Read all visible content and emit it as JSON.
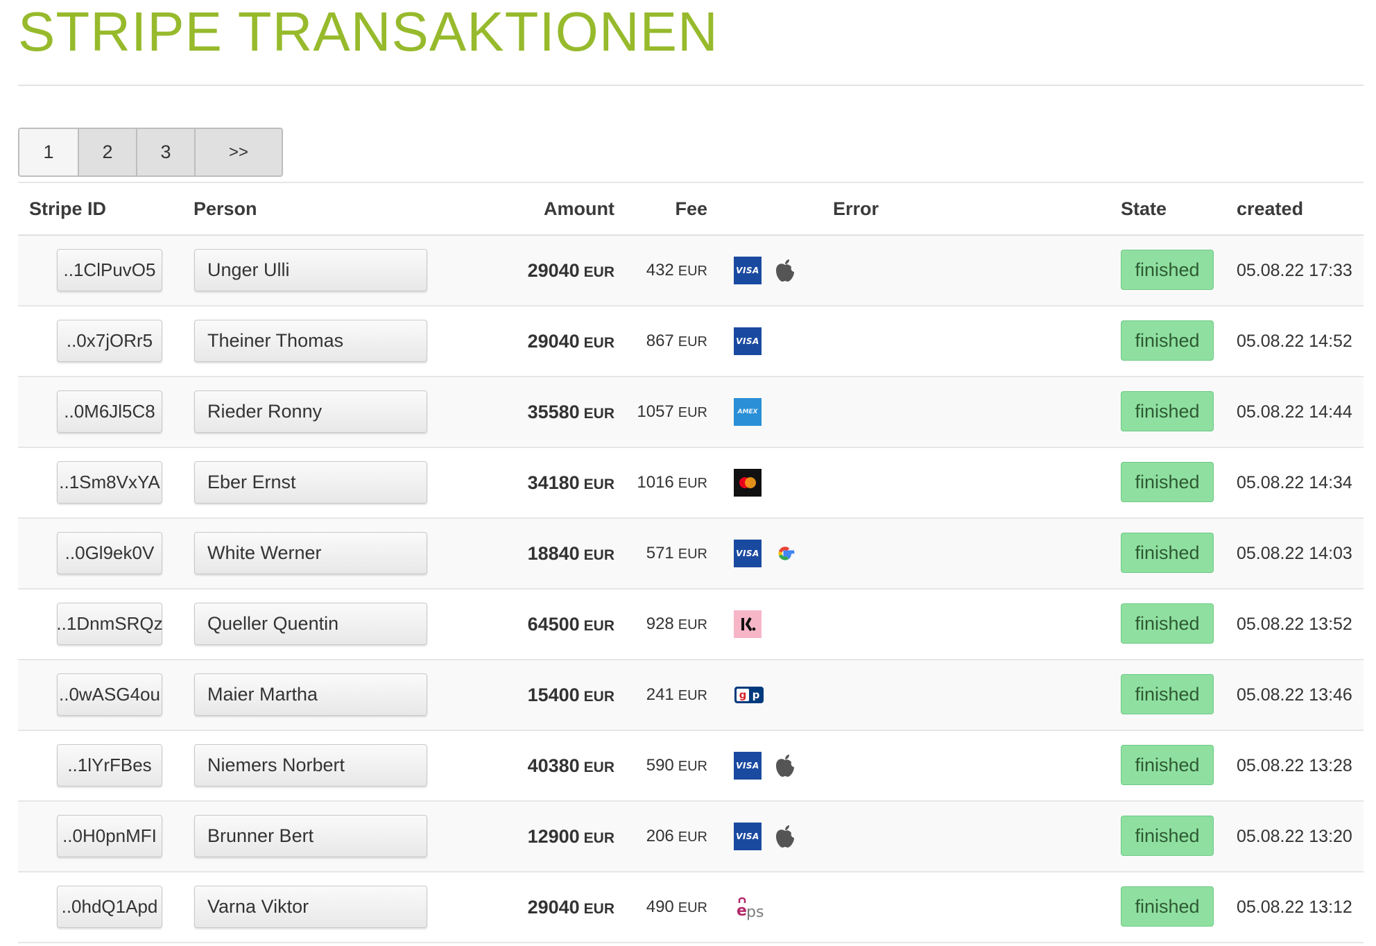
{
  "page": {
    "title": "STRIPE TRANSAKTIONEN"
  },
  "pagination": [
    "1",
    "2",
    "3",
    ">>"
  ],
  "columns": {
    "stripe_id": "Stripe ID",
    "person": "Person",
    "amount": "Amount",
    "fee": "Fee",
    "error": "Error",
    "state": "State",
    "created": "created"
  },
  "rows": [
    {
      "id": "..1ClPuvO5",
      "person": "Unger Ulli",
      "amount": "29040",
      "amount_cur": "EUR",
      "fee": "432",
      "fee_cur": "EUR",
      "methods": [
        "visa-icon",
        "apple-pay-icon"
      ],
      "state": "finished",
      "created": "05.08.22 17:33"
    },
    {
      "id": "..0x7jORr5",
      "person": "Theiner Thomas",
      "amount": "29040",
      "amount_cur": "EUR",
      "fee": "867",
      "fee_cur": "EUR",
      "methods": [
        "visa-icon"
      ],
      "state": "finished",
      "created": "05.08.22 14:52"
    },
    {
      "id": "..0M6Jl5C8",
      "person": "Rieder Ronny",
      "amount": "35580",
      "amount_cur": "EUR",
      "fee": "1057",
      "fee_cur": "EUR",
      "methods": [
        "amex-icon"
      ],
      "state": "finished",
      "created": "05.08.22 14:44"
    },
    {
      "id": "..1Sm8VxYA",
      "person": "Eber Ernst",
      "amount": "34180",
      "amount_cur": "EUR",
      "fee": "1016",
      "fee_cur": "EUR",
      "methods": [
        "mastercard-icon"
      ],
      "state": "finished",
      "created": "05.08.22 14:34"
    },
    {
      "id": "..0Gl9ek0V",
      "person": "White Werner",
      "amount": "18840",
      "amount_cur": "EUR",
      "fee": "571",
      "fee_cur": "EUR",
      "methods": [
        "visa-icon",
        "google-pay-icon"
      ],
      "state": "finished",
      "created": "05.08.22 14:03"
    },
    {
      "id": "..1DnmSRQz",
      "person": "Queller Quentin",
      "amount": "64500",
      "amount_cur": "EUR",
      "fee": "928",
      "fee_cur": "EUR",
      "methods": [
        "klarna-icon"
      ],
      "state": "finished",
      "created": "05.08.22 13:52"
    },
    {
      "id": "..0wASG4ou",
      "person": "Maier Martha",
      "amount": "15400",
      "amount_cur": "EUR",
      "fee": "241",
      "fee_cur": "EUR",
      "methods": [
        "giropay-icon"
      ],
      "state": "finished",
      "created": "05.08.22 13:46"
    },
    {
      "id": "..1lYrFBes",
      "person": "Niemers Norbert",
      "amount": "40380",
      "amount_cur": "EUR",
      "fee": "590",
      "fee_cur": "EUR",
      "methods": [
        "visa-icon",
        "apple-pay-icon"
      ],
      "state": "finished",
      "created": "05.08.22 13:28"
    },
    {
      "id": "..0H0pnMFI",
      "person": "Brunner Bert",
      "amount": "12900",
      "amount_cur": "EUR",
      "fee": "206",
      "fee_cur": "EUR",
      "methods": [
        "visa-icon",
        "apple-pay-icon"
      ],
      "state": "finished",
      "created": "05.08.22 13:20"
    },
    {
      "id": "..0hdQ1Apd",
      "person": "Varna Viktor",
      "amount": "29040",
      "amount_cur": "EUR",
      "fee": "490",
      "fee_cur": "EUR",
      "methods": [
        "eps-icon"
      ],
      "state": "finished",
      "created": "05.08.22 13:12"
    }
  ],
  "colors": {
    "title": "#97ba2c",
    "state_bg": "#8fe0a0",
    "visa": "#1a4aa0",
    "amex": "#2a8fd6",
    "klarna": "#f7b6c8"
  }
}
